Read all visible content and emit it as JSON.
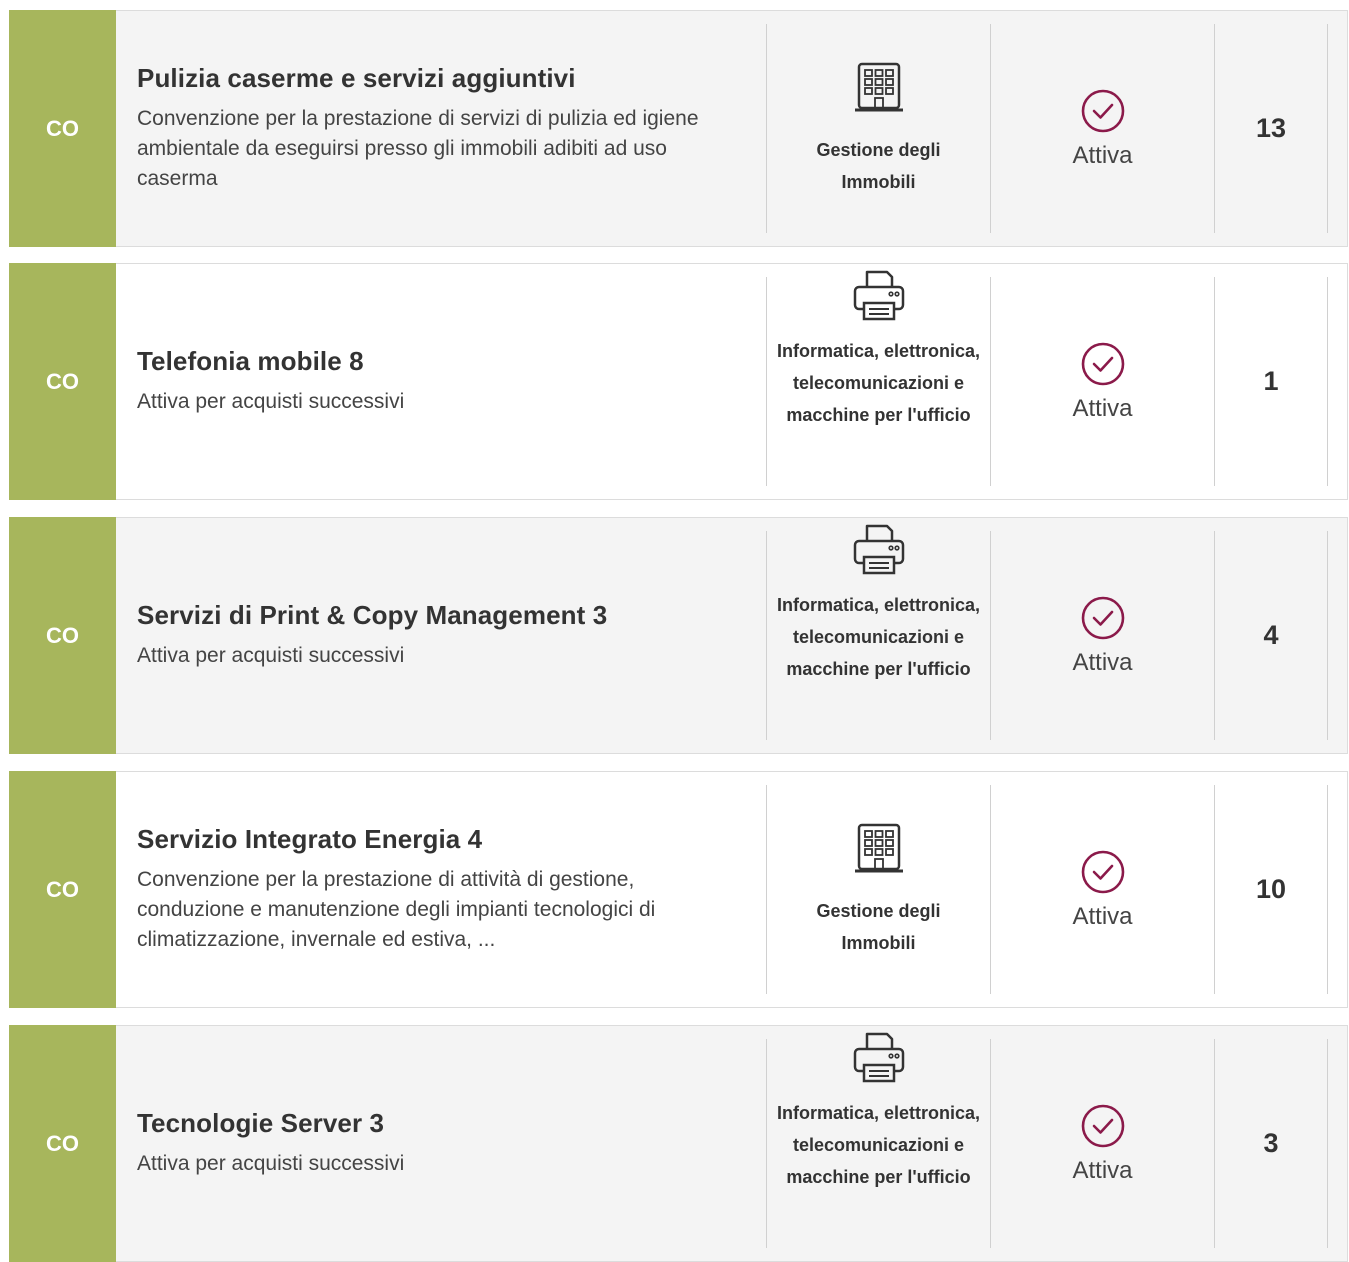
{
  "colors": {
    "tag": "#a7b65c",
    "status": "#8b1a4a"
  },
  "items": [
    {
      "tag": "CO",
      "title": "Pulizia caserme e servizi aggiuntivi",
      "description": "Convenzione per la prestazione di servizi di pulizia ed igiene ambientale da eseguirsi presso gli immobili adibiti ad uso caserma",
      "category": "Gestione degli Immobili",
      "category_icon": "building-icon",
      "status": "Attiva",
      "count": "13"
    },
    {
      "tag": "CO",
      "title": "Telefonia mobile 8",
      "description": "Attiva per acquisti successivi",
      "category": "Informatica, elettronica, telecomunicazioni e macchine per l'ufficio",
      "category_icon": "printer-icon",
      "status": "Attiva",
      "count": "1"
    },
    {
      "tag": "CO",
      "title": "Servizi di Print & Copy Management 3",
      "description": "Attiva per acquisti successivi",
      "category": "Informatica, elettronica, telecomunicazioni e macchine per l'ufficio",
      "category_icon": "printer-icon",
      "status": "Attiva",
      "count": "4"
    },
    {
      "tag": "CO",
      "title": "Servizio Integrato Energia 4",
      "description": "Convenzione per la prestazione di attività di gestione, conduzione e manutenzione degli impianti tecnologici di climatizzazione, invernale ed estiva, ...",
      "category": "Gestione degli Immobili",
      "category_icon": "building-icon",
      "status": "Attiva",
      "count": "10"
    },
    {
      "tag": "CO",
      "title": "Tecnologie Server 3",
      "description": "Attiva per acquisti successivi",
      "category": "Informatica, elettronica, telecomunicazioni e macchine per l'ufficio",
      "category_icon": "printer-icon",
      "status": "Attiva",
      "count": "3"
    }
  ]
}
